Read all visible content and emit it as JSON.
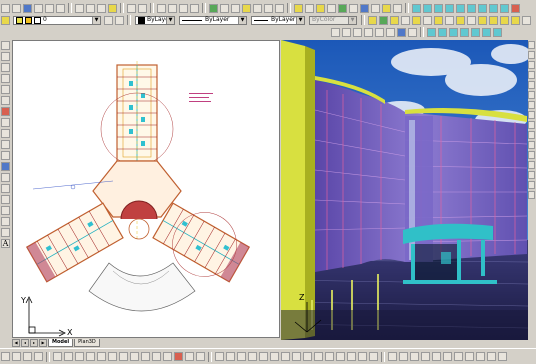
{
  "toolbar": {
    "layer_value": "0",
    "color_value": "ByLayer",
    "linetype_value": "ByLayer",
    "lineweight_value": "ByLayer",
    "plotstyle_value": "ByColor"
  },
  "tabs": [
    {
      "label": "Model",
      "active": true
    },
    {
      "label": "Plan3D",
      "active": false
    }
  ],
  "ucs": {
    "x_label": "X",
    "y_label": "Y",
    "z_label": "Z"
  },
  "colors": {
    "toolbar_bg": "#d4d0c8",
    "plan_bg": "#ffffff",
    "building_yellow": "#d8e040",
    "render_sky": "#3c74c8"
  }
}
